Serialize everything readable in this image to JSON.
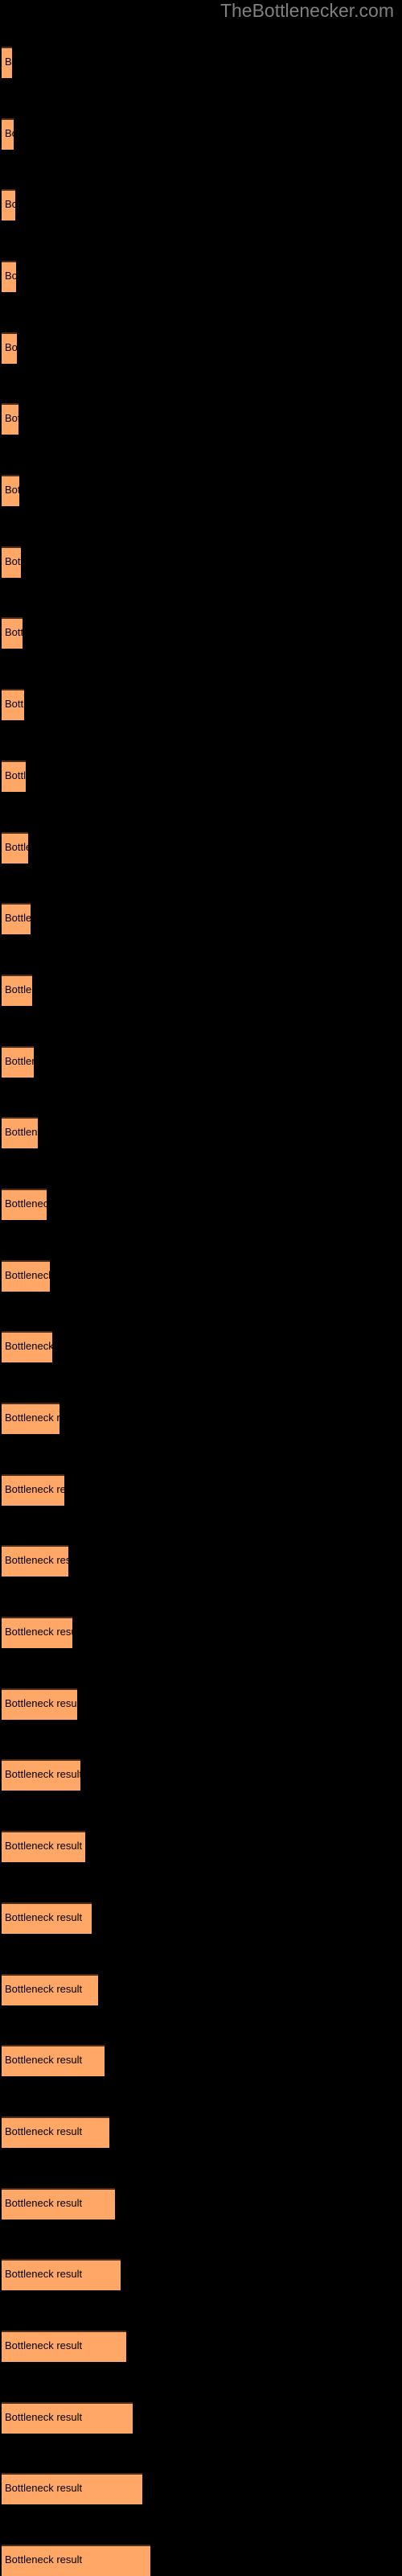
{
  "watermark": "TheBottlenecker.com",
  "background_color": "#000000",
  "bar_color": "#ffa766",
  "bar_edge_color": "#4d2d18",
  "label_color": "#000000",
  "watermark_color": "#808080",
  "bar_label": "Bottleneck result",
  "chart_data": {
    "type": "bar",
    "orientation": "horizontal",
    "title": "",
    "subtitle": "",
    "xlabel": "",
    "ylabel": "",
    "grid": false,
    "legend": null,
    "axis_visible": false,
    "tick_labels_visible": false,
    "bar_text": "Bottleneck result",
    "xlim": [
      0,
      500
    ],
    "categories": [
      "Bottleneck result",
      "Bottleneck result",
      "Bottleneck result",
      "Bottleneck result",
      "Bottleneck result",
      "Bottleneck result",
      "Bottleneck result",
      "Bottleneck result",
      "Bottleneck result",
      "Bottleneck result",
      "Bottleneck result",
      "Bottleneck result",
      "Bottleneck result",
      "Bottleneck result",
      "Bottleneck result",
      "Bottleneck result",
      "Bottleneck result",
      "Bottleneck result",
      "Bottleneck result",
      "Bottleneck result",
      "Bottleneck result",
      "Bottleneck result",
      "Bottleneck result",
      "Bottleneck result",
      "Bottleneck result",
      "Bottleneck result",
      "Bottleneck result",
      "Bottleneck result",
      "Bottleneck result",
      "Bottleneck result",
      "Bottleneck result",
      "Bottleneck result",
      "Bottleneck result",
      "Bottleneck result",
      "Bottleneck result",
      "Bottleneck result"
    ],
    "values": [
      13,
      15,
      17,
      18,
      19,
      21,
      22,
      24,
      26,
      28,
      30,
      33,
      36,
      38,
      40,
      45,
      56,
      60,
      63,
      72,
      78,
      83,
      88,
      94,
      98,
      104,
      112,
      120,
      128,
      134,
      141,
      148,
      155,
      163,
      175,
      185
    ],
    "bar_tops": [
      58,
      101,
      144,
      187,
      231,
      274,
      317,
      360,
      404,
      447,
      490,
      533,
      577,
      620,
      663,
      706,
      750,
      793,
      836,
      879,
      923,
      966,
      1009,
      1052,
      1096,
      1139,
      1182,
      1225,
      1269,
      1312,
      1355,
      1398,
      1442,
      1485,
      1528,
      1571
    ]
  }
}
